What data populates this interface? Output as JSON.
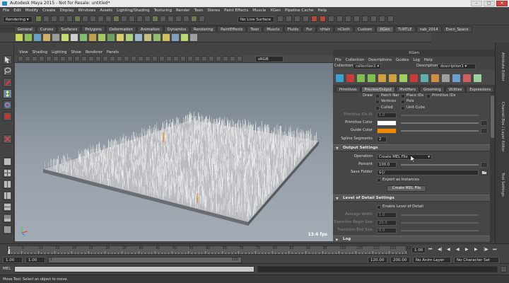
{
  "window": {
    "title": "Autodesk Maya 2015 - Not for Resale: untitled*"
  },
  "menubar": [
    "File",
    "Edit",
    "Modify",
    "Create",
    "Display",
    "Windows",
    "Assets",
    "Lighting/Shading",
    "Texturing",
    "Render",
    "Toon",
    "Stereo",
    "Paint Effects",
    "Muscle",
    "XGen",
    "Pipeline Cache",
    "Help"
  ],
  "statusline": {
    "menuset": "Rendering",
    "live_surface": "No Live Surface"
  },
  "shelf_tabs": [
    "General",
    "Curves",
    "Surfaces",
    "Polygons",
    "Deformation",
    "Animation",
    "Dynamics",
    "Rendering",
    "PaintEffects",
    "Toon",
    "Muscle",
    "Fluids",
    "Fur",
    "nHair",
    "nCloth",
    "Custom",
    "XGen",
    "TURTLE",
    "nab_2014",
    "Even_Space"
  ],
  "shelf_active": "XGen",
  "viewport": {
    "menu": [
      "View",
      "Shading",
      "Lighting",
      "Show",
      "Renderer",
      "Panels"
    ],
    "renderer": "sRGB gamma",
    "fps": "13.6 fps"
  },
  "xgen": {
    "title": "XGen",
    "menu": [
      "File",
      "Collection",
      "Descriptions",
      "Guides",
      "Log",
      "Help"
    ],
    "collection_label": "Collection",
    "collection_value": "collection1",
    "description_label": "Description",
    "description_value": "description1",
    "tabs": [
      "Primitives",
      "Preview/Output",
      "Modifiers",
      "Grooming",
      "Utilities",
      "Expressions"
    ],
    "active_tab": "Preview/Output",
    "draw_label": "Draw",
    "draw_checks": [
      {
        "label": "Patch Nar",
        "checked": false
      },
      {
        "label": "Place IDs",
        "checked": false
      },
      {
        "label": "Primitive IDs",
        "checked": false
      },
      {
        "label": "Vertices",
        "checked": false
      },
      {
        "label": "Pols",
        "checked": false
      },
      {
        "label": "Culled",
        "checked": false
      },
      {
        "label": "Unit Cube",
        "checked": false
      }
    ],
    "primitive_ids_at_label": "Primitive IDs At",
    "primitive_ids_at_value": "1.0",
    "primitive_color_label": "Primitive Color",
    "guide_color_label": "Guide Color",
    "spline_segments_label": "Spline Segments",
    "spline_segments_value": "2",
    "output_section": "Output Settings",
    "operation_label": "Operation",
    "operation_value": "Create MEL File",
    "percent_label": "Percent",
    "percent_value": "100.0",
    "save_folder_label": "Save Folder",
    "save_folder_value": "${/",
    "export_instances_label": "Export as Instances",
    "create_mel_button": "Create MEL File",
    "lod_section": "Level of Detail Settings",
    "enable_lod_label": "Enable Level of Detail",
    "average_width_label": "Average Width",
    "average_width_value": "1.0",
    "transition_begin_label": "Transition Begin Size",
    "transition_begin_value": "20.0",
    "transition_end_label": "Transition End Size",
    "transition_end_value": "0.0",
    "log_section": "Log",
    "colors": {
      "primitive": "#ffffff",
      "guide": "#f08a00"
    }
  },
  "sidestrip": [
    "Attribute Editor",
    "Channel Box / Layer Editor",
    "Tool Settings"
  ],
  "timeslider": {
    "ticks": [
      "1",
      "5",
      "10",
      "15",
      "20",
      "25",
      "30",
      "35",
      "40",
      "45",
      "50",
      "55",
      "60",
      "65",
      "70",
      "75",
      "80",
      "85",
      "90",
      "95",
      "100",
      "105",
      "110",
      "115",
      "120"
    ],
    "current_frame": "1.00"
  },
  "rangeslider": {
    "start": "1.00",
    "inner_start": "1.00",
    "inner_start_box": "1",
    "inner_end_box": "120",
    "end": "120.00",
    "end2": "200.00",
    "anim_layer": "No Anim Layer",
    "char_set": "No Character Set"
  },
  "cmdline": {
    "label": "MEL"
  },
  "helpline": {
    "text": "Move Tool: Select an object to move."
  }
}
